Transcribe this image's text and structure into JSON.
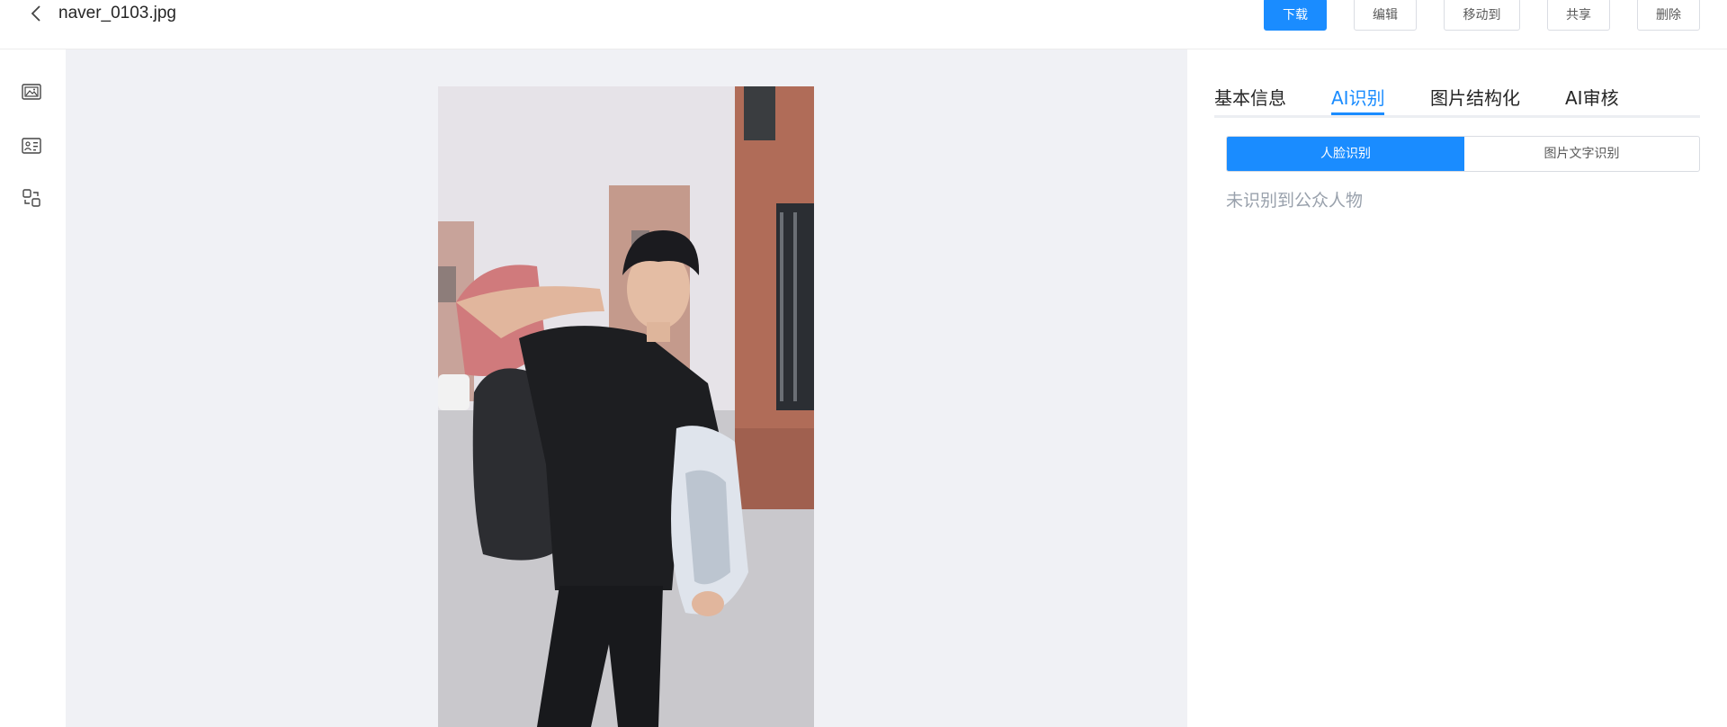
{
  "header": {
    "file_name": "naver_0103.jpg",
    "actions": {
      "download": "下载",
      "edit": "编辑",
      "move_to": "移动到",
      "share": "共享",
      "delete": "删除"
    }
  },
  "rail": {
    "icons": [
      "gallery-icon",
      "image-info-icon",
      "compare-icon"
    ]
  },
  "panel": {
    "tabs": [
      "基本信息",
      "AI识别",
      "图片结构化",
      "AI审核"
    ],
    "active_tab": "AI识别",
    "segments": [
      "人脸识别",
      "图片文字识别"
    ],
    "active_segment": "人脸识别",
    "result_text": "未识别到公众人物"
  },
  "colors": {
    "accent": "#1A8CFF",
    "background": "#F0F1F5",
    "text": "#262626",
    "muted": "#99A1AC"
  }
}
